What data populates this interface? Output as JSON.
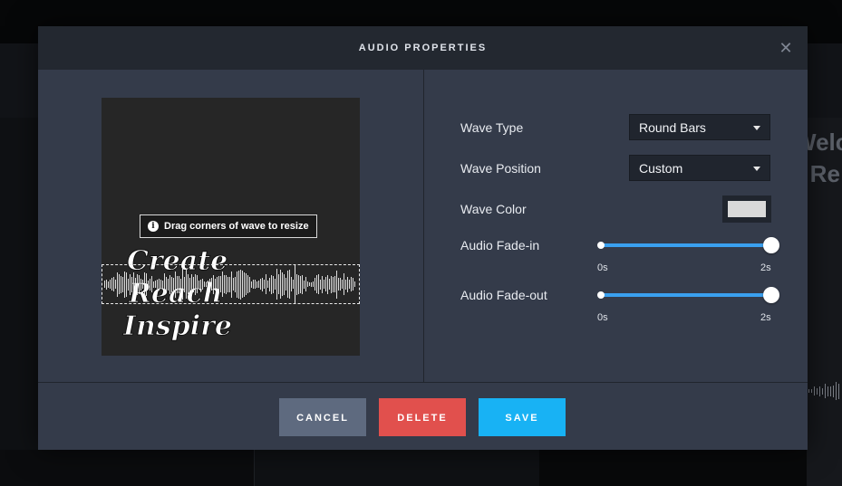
{
  "background": {
    "heading_line1": "Welco",
    "heading_line2": "e Re"
  },
  "modal": {
    "title": "AUDIO PROPERTIES",
    "close_icon": "close-icon",
    "preview": {
      "hint_icon": "info-icon",
      "hint_text": "Drag corners of wave to resize",
      "logo_line1": "Create",
      "logo_line2": "Reach",
      "logo_line3": "Inspire"
    },
    "properties": {
      "wave_type": {
        "label": "Wave Type",
        "value": "Round Bars"
      },
      "wave_position": {
        "label": "Wave Position",
        "value": "Custom"
      },
      "wave_color": {
        "label": "Wave Color",
        "value": "#d9d9d9"
      },
      "fade_in": {
        "label": "Audio Fade-in",
        "min_label": "0s",
        "max_label": "2s",
        "level": 1.0
      },
      "fade_out": {
        "label": "Audio Fade-out",
        "min_label": "0s",
        "max_label": "2s",
        "level": 1.0
      }
    },
    "buttons": {
      "cancel": "CANCEL",
      "delete": "DELETE",
      "save": "SAVE"
    }
  },
  "colors": {
    "accent": "#18b2f4",
    "danger": "#e1504d",
    "neutral_button": "#5e6a7f",
    "modal_bg": "#343b4a",
    "header_bg": "#232830"
  }
}
